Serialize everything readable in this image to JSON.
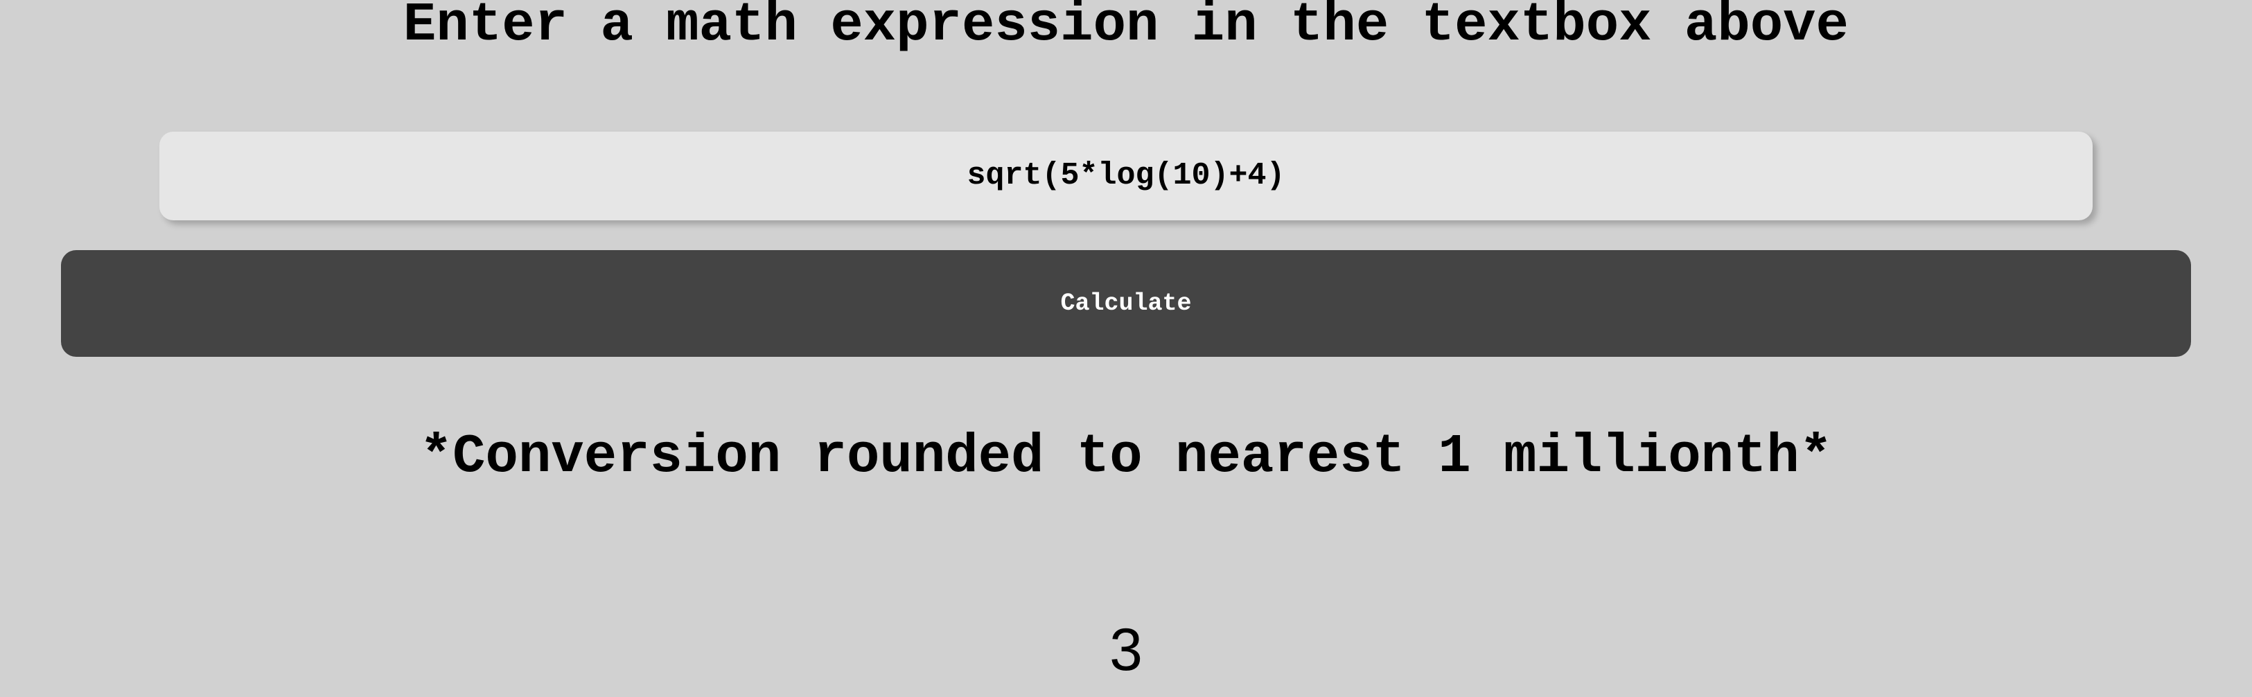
{
  "app": {
    "background_color": "#d1d1d1",
    "text_color": "#000000"
  },
  "prompt": {
    "heading": "Enter a math expression in the textbox above"
  },
  "expression_field": {
    "value": "sqrt(5*log(10)+4)",
    "placeholder": "Enter a math expression",
    "background_color": "#e6e6e6"
  },
  "actions": {
    "calculate_label": "Calculate",
    "calculate_background_color": "#444444",
    "calculate_text_color": "#ffffff"
  },
  "notes": {
    "rounding": "*Conversion rounded to nearest 1 millionth*"
  },
  "result": {
    "value": "3"
  }
}
